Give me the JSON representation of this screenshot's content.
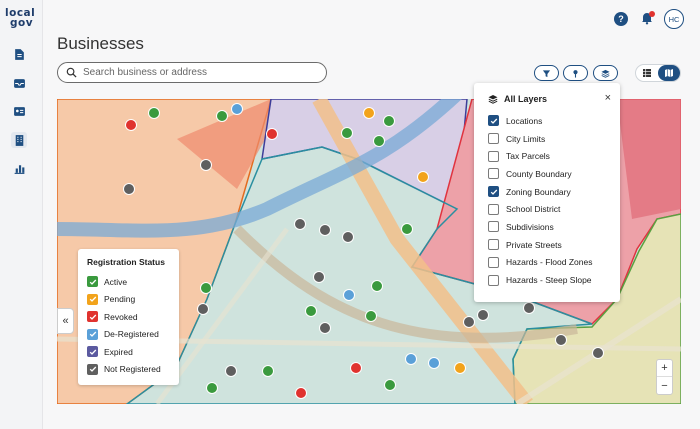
{
  "app": {
    "logo_line1": "local",
    "logo_line2": "gov"
  },
  "header": {
    "title": "Businesses",
    "help_icon": "help-icon",
    "notifications_icon": "bell-icon",
    "user_initials": "HC"
  },
  "sidebar": {
    "items": [
      {
        "icon": "document-icon"
      },
      {
        "icon": "inbox-icon"
      },
      {
        "icon": "contact-card-icon"
      },
      {
        "icon": "building-icon",
        "active": true
      },
      {
        "icon": "bar-chart-icon"
      }
    ]
  },
  "search": {
    "placeholder": "Search business or address",
    "value": ""
  },
  "toolbar": {
    "filter_icon": "filter-icon",
    "pin_icon": "pin-icon",
    "layers_icon": "layers-icon",
    "view_list_icon": "list-view-icon",
    "view_map_icon": "map-view-icon",
    "active_view": "map"
  },
  "legend": {
    "title": "Registration Status",
    "items": [
      {
        "label": "Active",
        "color": "#3a9a3e"
      },
      {
        "label": "Pending",
        "color": "#f2a31b"
      },
      {
        "label": "Revoked",
        "color": "#e0332f"
      },
      {
        "label": "De-Registered",
        "color": "#5aa0d8"
      },
      {
        "label": "Expired",
        "color": "#5b5aa0"
      },
      {
        "label": "Not Registered",
        "color": "#5f5f5f"
      }
    ]
  },
  "layers": {
    "title": "All Layers",
    "close": "×",
    "items": [
      {
        "label": "Locations",
        "checked": true
      },
      {
        "label": "City Limits",
        "checked": false
      },
      {
        "label": "Tax Parcels",
        "checked": false
      },
      {
        "label": "County Boundary",
        "checked": false
      },
      {
        "label": "Zoning Boundary",
        "checked": true
      },
      {
        "label": "School District",
        "checked": false
      },
      {
        "label": "Subdivisions",
        "checked": false
      },
      {
        "label": "Private Streets",
        "checked": false
      },
      {
        "label": "Hazards - Flood Zones",
        "checked": false
      },
      {
        "label": "Hazards - Steep Slope",
        "checked": false
      }
    ]
  },
  "map": {
    "collapse": "«",
    "zoom_in": "+",
    "zoom_out": "−"
  },
  "colors": {
    "brand": "#1f4f82",
    "notification_dot": "#e0332f"
  }
}
